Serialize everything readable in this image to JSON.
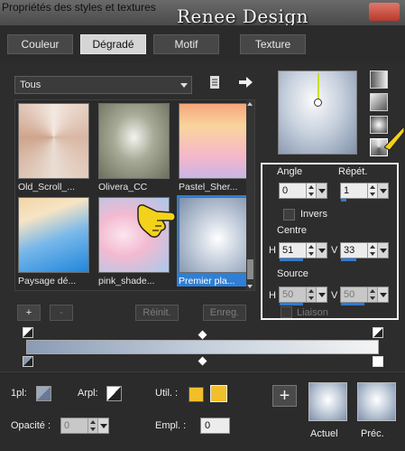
{
  "window": {
    "title": "Propriétés des styles et textures",
    "watermark": "Renee Design"
  },
  "tabs": [
    {
      "label": "Couleur",
      "active": false
    },
    {
      "label": "Dégradé",
      "active": true
    },
    {
      "label": "Motif",
      "active": false
    },
    {
      "label": "Texture",
      "active": false
    }
  ],
  "library": {
    "category": "Tous",
    "items": [
      {
        "label": "Old_Scroll_...",
        "selected": false
      },
      {
        "label": "Olivera_CC",
        "selected": false
      },
      {
        "label": "Pastel_Sher...",
        "selected": false
      },
      {
        "label": "Paysage dé...",
        "selected": false
      },
      {
        "label": "pink_shade...",
        "selected": false
      },
      {
        "label": "Premier pla...",
        "selected": true
      }
    ],
    "add_label": "+",
    "remove_label": "-",
    "reset_label": "Réinit.",
    "save_label": "Enreg."
  },
  "settings": {
    "angle_label": "Angle",
    "angle_value": "0",
    "repeat_label": "Répét.",
    "repeat_value": "1",
    "invert_label": "Invers",
    "center_label": "Centre",
    "center_h_label": "H",
    "center_h_value": "51",
    "center_v_label": "V",
    "center_v_value": "33",
    "source_label": "Source",
    "source_h_label": "H",
    "source_h_value": "50",
    "source_v_label": "V",
    "source_v_value": "50",
    "link_label": "Liaison"
  },
  "bottom": {
    "pl_label": "1pl:",
    "arpl_label": "Arpl:",
    "util_label": "Util. :",
    "opacity_label": "Opacité :",
    "opacity_value": "0",
    "empl_label": "Empl. :",
    "empl_value": "0",
    "add_label": "+",
    "current_label": "Actuel",
    "previous_label": "Préc."
  },
  "colors": {
    "accent": "#2f7fd6",
    "util_color": "#f1bf2a",
    "highlight_hand": "#f3d21a"
  }
}
